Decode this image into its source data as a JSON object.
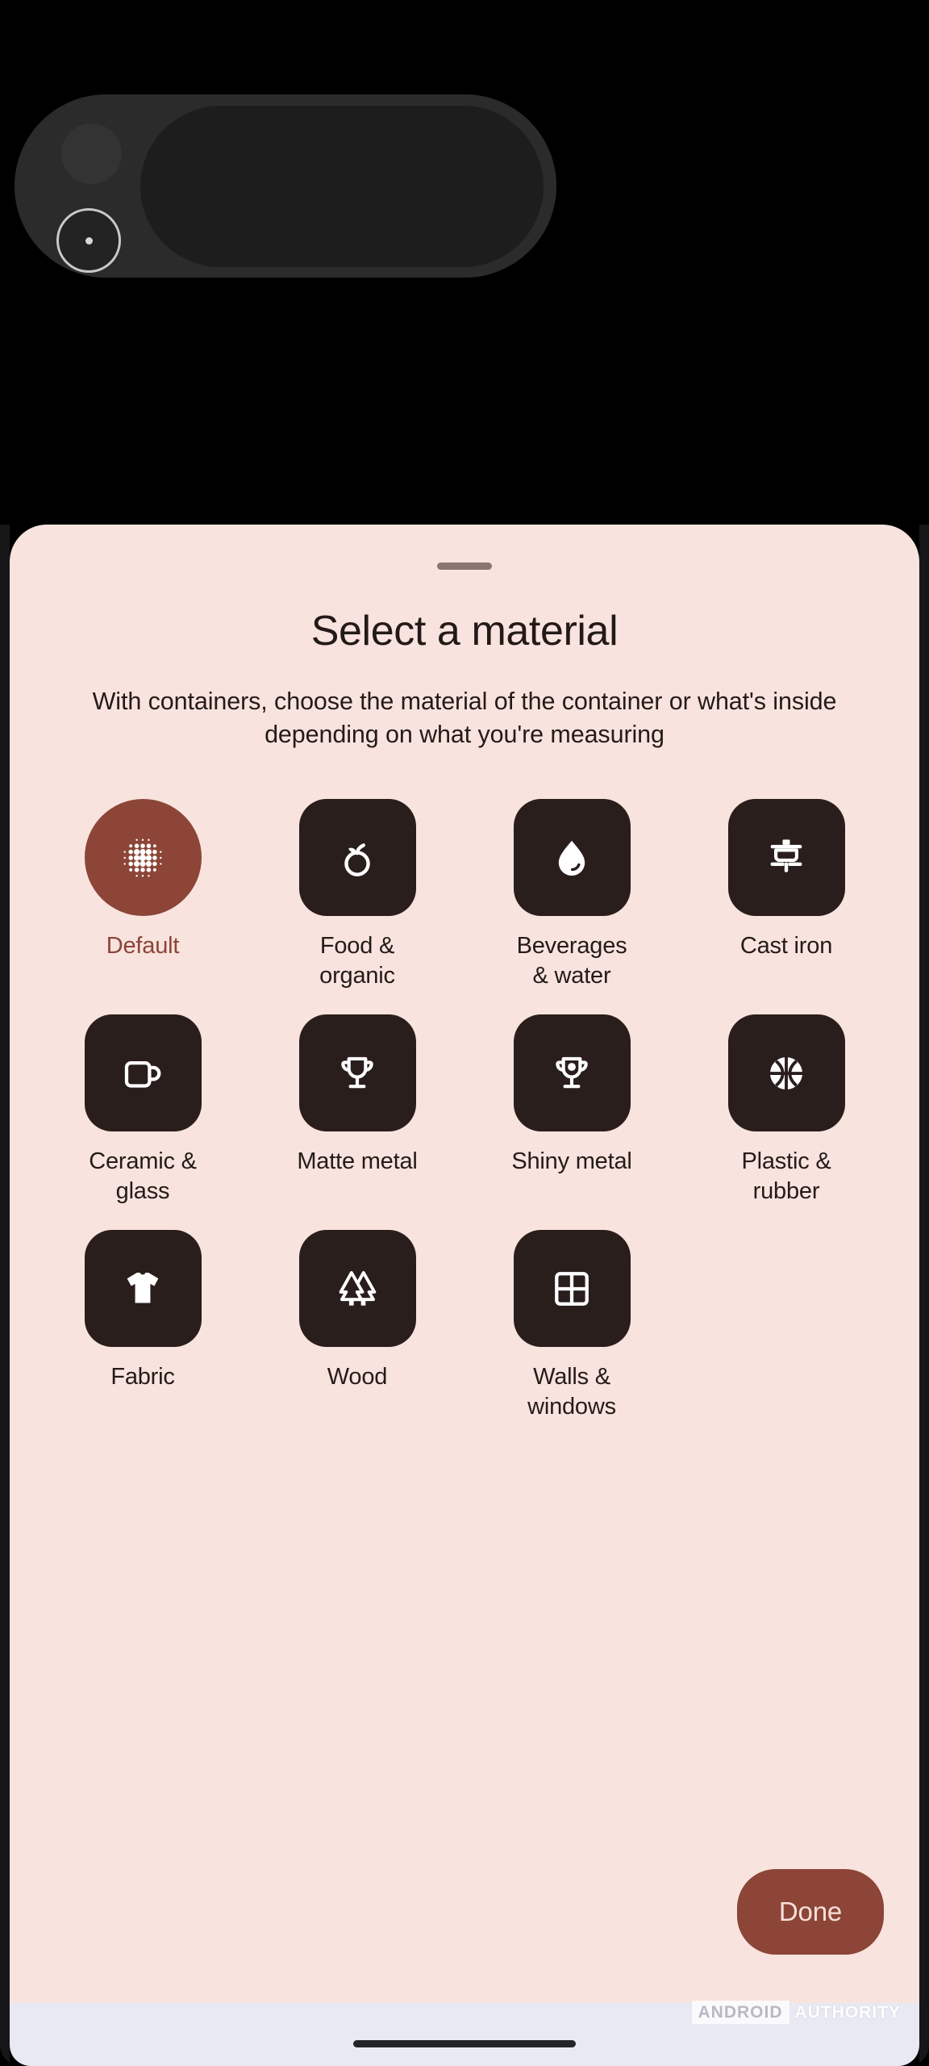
{
  "sheet": {
    "title": "Select a material",
    "description": "With containers, choose the material of the container or what's inside depending on what you're measuring",
    "done_label": "Done",
    "accent_color": "#8c4537",
    "sheet_background": "#f8e3de",
    "tile_color": "#2a1e1c"
  },
  "materials": [
    {
      "label": "Default",
      "icon": "dot-grid-icon",
      "selected": true
    },
    {
      "label": "Food & organic",
      "icon": "apple-icon",
      "selected": false
    },
    {
      "label": "Beverages & water",
      "icon": "water-drop-icon",
      "selected": false
    },
    {
      "label": "Cast iron",
      "icon": "skillet-icon",
      "selected": false
    },
    {
      "label": "Ceramic & glass",
      "icon": "mug-icon",
      "selected": false
    },
    {
      "label": "Matte metal",
      "icon": "trophy-icon",
      "selected": false
    },
    {
      "label": "Shiny metal",
      "icon": "trophy-shine-icon",
      "selected": false
    },
    {
      "label": "Plastic & rubber",
      "icon": "basketball-icon",
      "selected": false
    },
    {
      "label": "Fabric",
      "icon": "tshirt-icon",
      "selected": false
    },
    {
      "label": "Wood",
      "icon": "pine-trees-icon",
      "selected": false
    },
    {
      "label": "Walls & windows",
      "icon": "window-grid-icon",
      "selected": false
    }
  ],
  "watermark": {
    "first": "ANDROID",
    "second": "AUTHORITY"
  }
}
